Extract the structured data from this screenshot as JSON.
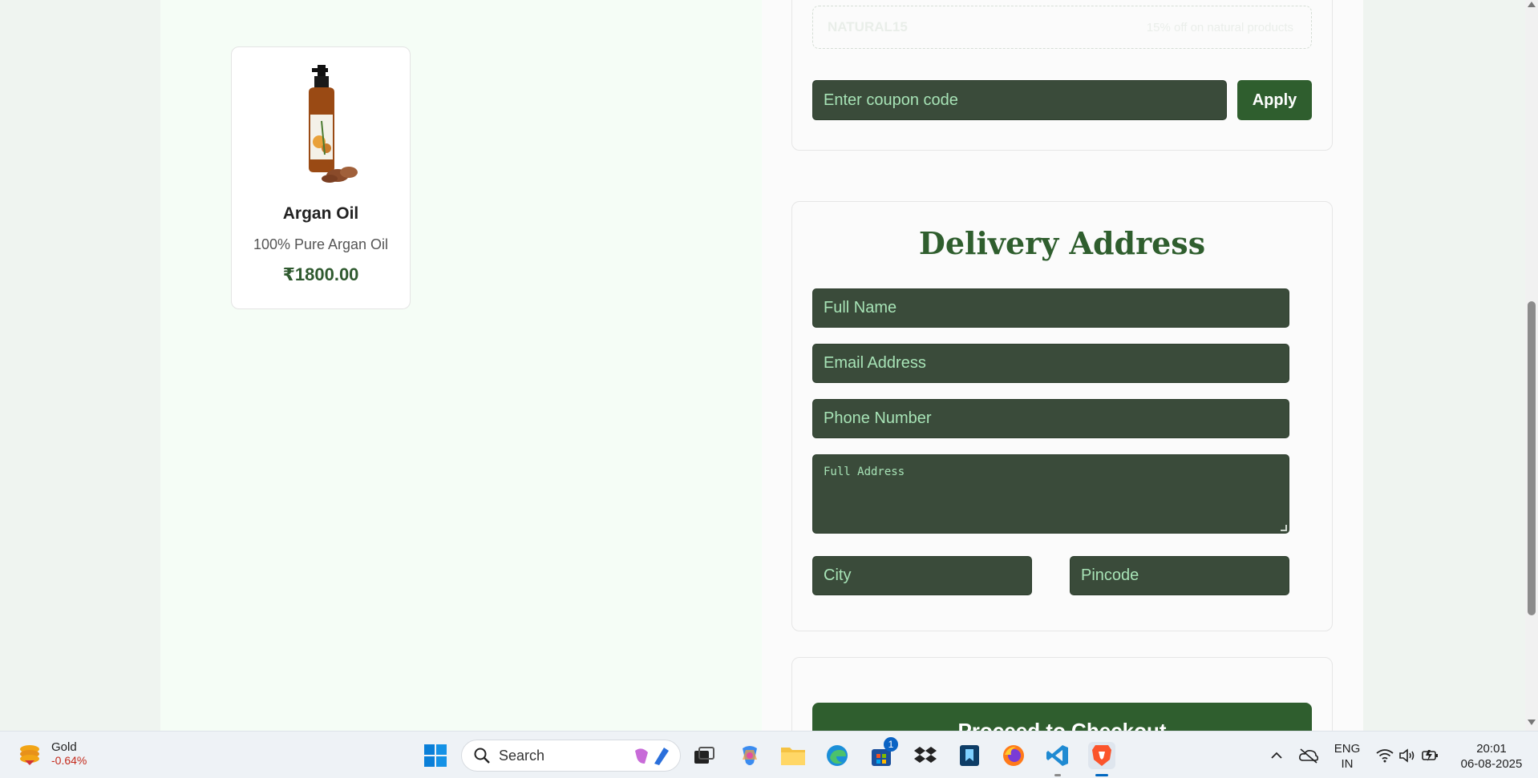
{
  "coupon": {
    "hint_code": "NATURAL15",
    "hint_note": "15% off on natural products",
    "input_placeholder": "Enter coupon code",
    "apply_label": "Apply"
  },
  "product": {
    "name": "Argan Oil",
    "description": "100% Pure Argan Oil",
    "price": "₹1800.00",
    "image_label": "ARGAN OIL"
  },
  "delivery": {
    "title": "Delivery Address",
    "full_name_placeholder": "Full Name",
    "email_placeholder": "Email Address",
    "phone_placeholder": "Phone Number",
    "address_placeholder": "Full Address",
    "city_placeholder": "City",
    "pincode_placeholder": "Pincode"
  },
  "checkout": {
    "button_label": "Proceed to Checkout"
  },
  "taskbar": {
    "widget_title": "Gold",
    "widget_change": "-0.64%",
    "search_label": "Search",
    "store_badge": "1",
    "lang_line1": "ENG",
    "lang_line2": "IN",
    "time": "20:01",
    "date": "06-08-2025"
  },
  "colors": {
    "accent_green": "#2f5e2e",
    "field_bg": "#3a4b3a",
    "field_text": "#a7e3b6",
    "taskbar_active": "#0067c0"
  }
}
